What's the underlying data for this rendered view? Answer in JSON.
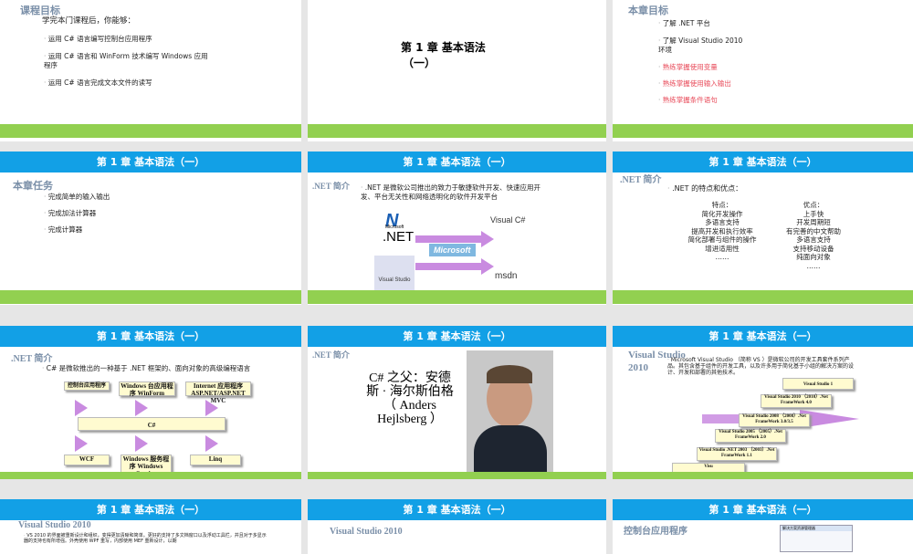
{
  "header": "第 1 章 基本语法（一）",
  "s1": {
    "title": "课程目标",
    "intro": "学完本门课程后，你能够：",
    "items": [
      "运用 C# 语言编写控制台应用程序",
      "运用 C# 语言和 WinForm 技术编写 Windows 应用程序",
      "运用 C# 语言完成文本文件的读写"
    ]
  },
  "s2": {
    "title": "第 1 章 基本语法",
    "sub": "（一）"
  },
  "s3": {
    "title": "本章目标",
    "items": [
      "了解 .NET 平台",
      "了解 Visual Studio 2010 环境"
    ],
    "red_items": [
      "熟练掌握使用变量",
      "熟练掌握使用输入输出",
      "熟练掌握条件语句"
    ]
  },
  "s4": {
    "title": "本章任务",
    "items": [
      "完成简单的输入输出",
      "完成加法计算器",
      "完成计算器"
    ]
  },
  "s5": {
    "title": ".NET 简介",
    "text": ".NET 是微软公司推出的致力于敏捷软件开发、快速应用开发、平台无关性和网络透明化的软件开发平台",
    "logos": {
      "ms": "Microsoft",
      "net": ".NET",
      "center": "Microsoft",
      "vcs": "Visual C#",
      "vs": "Visual Studio",
      "msdn": "msdn"
    }
  },
  "s6": {
    "title": ".NET 简介",
    "intro": ".NET 的特点和优点：",
    "feat_title": "特点：",
    "features": [
      "简化开发操作",
      "多语言支持",
      "提高开发和执行效率",
      "简化部署与组件的操作",
      "增进适用性",
      "……"
    ],
    "adv_title": "优点：",
    "advantages": [
      "上手快",
      "开发周期短",
      "有完善的中文帮助",
      "多语言支持",
      "支持移动设备",
      "纯面向对象",
      "……"
    ]
  },
  "s7": {
    "title": ".NET 简介",
    "text": "C# 是微软推出的一种基于 .NET 框架的、面向对象的高级编程语言",
    "top": [
      "控制台应用程序",
      "Windows 台应用程序 WinForm",
      "Internet 应用程序 ASP.NET/ASP.NET MVC"
    ],
    "center": "C#",
    "bottom": [
      "WCF",
      "Windows 服务程序 Windows Service",
      "Linq"
    ]
  },
  "s8": {
    "title": ".NET 简介",
    "caption": "C# 之父：安德斯 · 海尔斯伯格 （ Anders Hejlsberg ）"
  },
  "s9": {
    "title": "Visual Studio 2010",
    "text": "Microsoft Visual Studio （简称 VS ）是微软公司的开发工具套件系列产品。其包含基于组件的开发工具，以及许多用于简化基于小组的解决方案的设计、开发和部署的其他技术。",
    "steps": [
      "Visual Studio 1",
      "Visual Studio 2010 （2010）.Net FrameWork 4.0",
      "Visual Studio 2008 （2008）.Net FrameWork 3.0/3.5",
      "Visual Studio 2005 （2005）.Net FrameWork 2.0",
      "Visual Studio .NET 2003 （2003）.Net FrameWork 1.1",
      "Visu"
    ]
  },
  "s10": {
    "title": "Visual Studio 2010",
    "text": "VS 2010 的界面被重新设计和组织，变得更加清晰和简单。更好的支持了多文档窗口以及浮动工具栏，并且对于多显示器的支持也有所增强。外壳使用 WPF 重写，内部使用 MEF 重新设计，以期"
  },
  "s11": {
    "title": "Visual Studio 2010"
  },
  "s12": {
    "title": "控制台应用程序",
    "thumb": "解决方案资源管理器"
  }
}
